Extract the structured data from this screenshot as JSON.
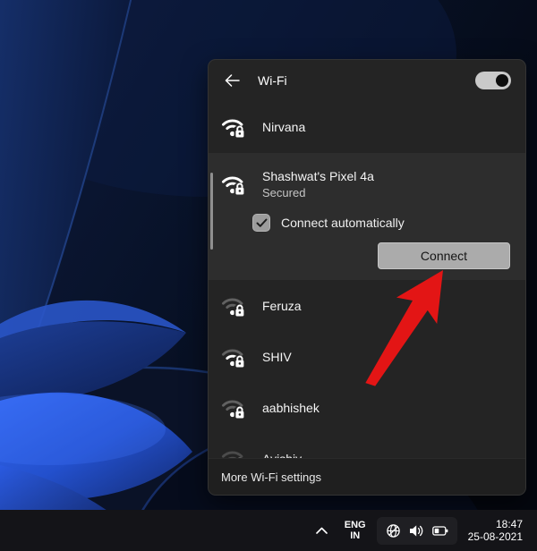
{
  "colors": {
    "panel_bg": "#242424",
    "expanded_item_bg": "#2d2d2d",
    "toggle_on": "#c9c9c9",
    "connect_button_bg": "#ababab",
    "annotation_arrow": "#e31515",
    "taskbar_bg": "#141418",
    "wallpaper_blue": "#2a55c8"
  },
  "flyout": {
    "header": {
      "title": "Wi-Fi",
      "toggle_state": "on"
    },
    "networks": [
      {
        "name": "Nirvana",
        "secured": true,
        "strength": 3
      },
      {
        "name": "Shashwat's Pixel 4a",
        "status": "Secured",
        "secured": true,
        "strength": 3,
        "expanded": true,
        "checkbox_label": "Connect automatically",
        "checkbox_checked": true,
        "connect_label": "Connect"
      },
      {
        "name": "Feruza",
        "secured": true,
        "strength": 1
      },
      {
        "name": "SHIV",
        "secured": true,
        "strength": 2
      },
      {
        "name": "aabhishek",
        "secured": true,
        "strength": 1
      },
      {
        "name": "Avishiv",
        "secured": true,
        "strength": 1,
        "partially_visible": true
      }
    ],
    "footer": {
      "label": "More Wi-Fi settings"
    }
  },
  "taskbar": {
    "language": {
      "line1": "ENG",
      "line2": "IN"
    },
    "tray_icons": [
      "network-globe",
      "volume",
      "battery"
    ],
    "clock": {
      "time": "18:47",
      "date": "25-08-2021"
    }
  },
  "annotation": {
    "type": "arrow",
    "points_to": "connect-button"
  }
}
